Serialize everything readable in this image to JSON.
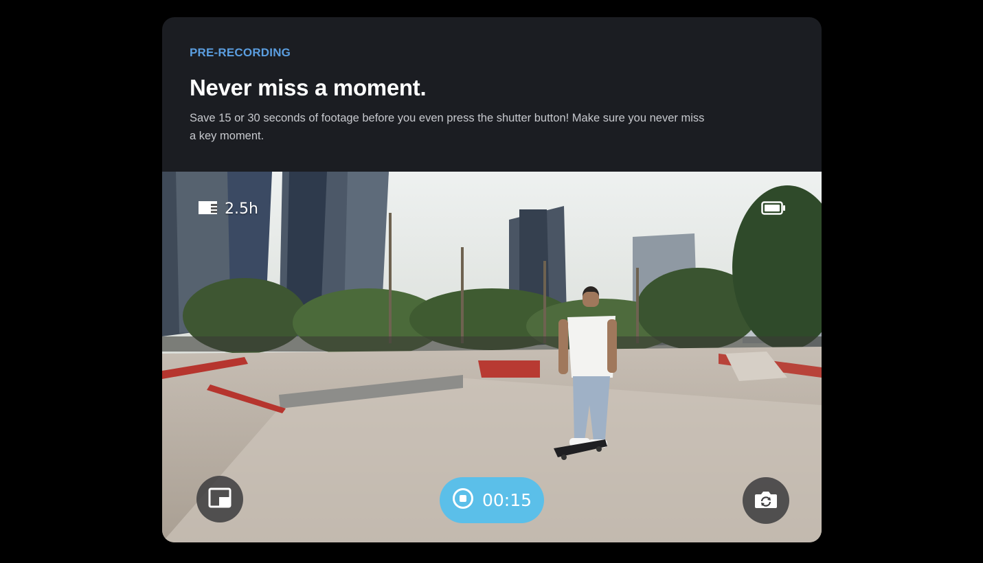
{
  "header": {
    "eyebrow": "PRE-RECORDING",
    "title": "Never miss a moment.",
    "description": "Save 15 or 30 seconds of footage before you even press the shutter button! Make sure you never miss a key moment."
  },
  "viewfinder": {
    "storage_remaining": "2.5h",
    "record_timer": "00:15",
    "icons": {
      "storage": "sd-card-icon",
      "battery": "battery-full-icon",
      "pip": "picture-in-picture-icon",
      "record": "stop-record-icon",
      "flip": "camera-switch-icon"
    }
  },
  "colors": {
    "accent": "#5bbfe9",
    "eyebrow": "#5b9ee0",
    "card_bg": "#1b1d22"
  }
}
